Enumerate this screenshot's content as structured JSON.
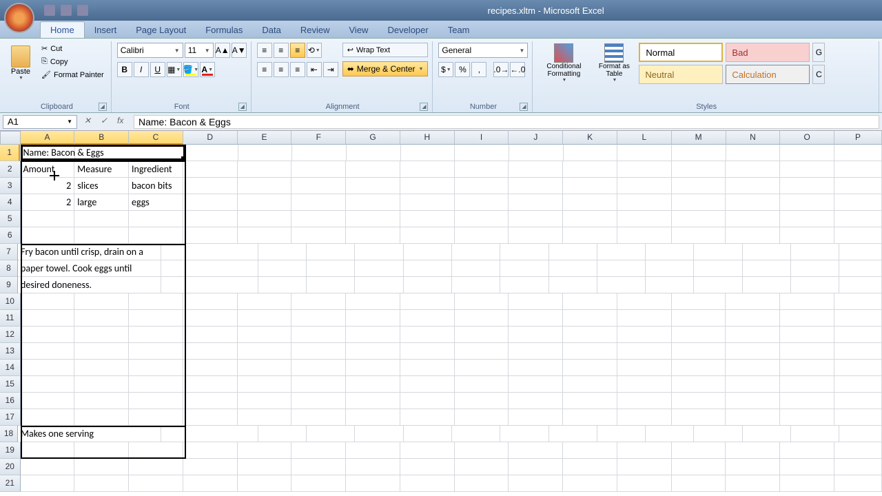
{
  "window_title": "recipes.xltm - Microsoft Excel",
  "tabs": [
    "Home",
    "Insert",
    "Page Layout",
    "Formulas",
    "Data",
    "Review",
    "View",
    "Developer",
    "Team"
  ],
  "active_tab": "Home",
  "clipboard": {
    "paste": "Paste",
    "cut": "Cut",
    "copy": "Copy",
    "format_painter": "Format Painter",
    "group": "Clipboard"
  },
  "font": {
    "name": "Calibri",
    "size": "11",
    "group": "Font"
  },
  "alignment": {
    "wrap": "Wrap Text",
    "merge": "Merge & Center",
    "group": "Alignment"
  },
  "number": {
    "format": "General",
    "group": "Number"
  },
  "styles": {
    "group": "Styles",
    "conditional": "Conditional Formatting",
    "format_table": "Format as Table",
    "normal": "Normal",
    "bad": "Bad",
    "neutral": "Neutral",
    "calculation": "Calculation"
  },
  "name_box": "A1",
  "formula": "Name: Bacon & Eggs",
  "columns": [
    "A",
    "B",
    "C",
    "D",
    "E",
    "F",
    "G",
    "H",
    "I",
    "J",
    "K",
    "L",
    "M",
    "N",
    "O",
    "P"
  ],
  "selected_cols": [
    "A",
    "B",
    "C"
  ],
  "selected_row": 1,
  "rows_visible": 21,
  "cells": {
    "A1": "Name: Bacon & Eggs",
    "A2": "Amount",
    "B2": "Measure",
    "C2": "Ingredient",
    "A3": "2",
    "B3": "slices",
    "C3": "bacon bits",
    "A4": "2",
    "B4": "large",
    "C4": "eggs",
    "A7": "Fry bacon until crisp, drain on a",
    "A8": "paper towel. Cook eggs until",
    "A9": "desired doneness.",
    "A18": "Makes one serving"
  }
}
